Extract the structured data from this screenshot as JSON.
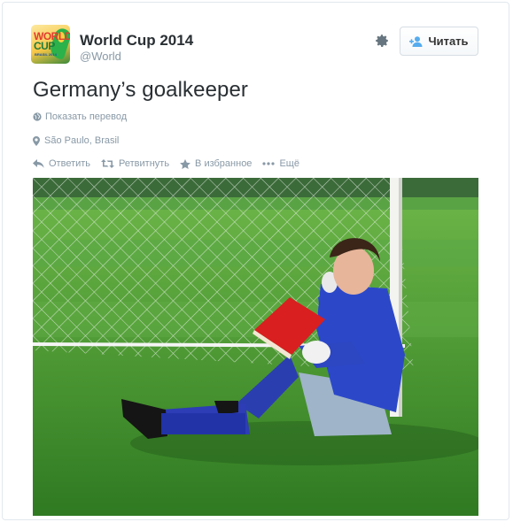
{
  "account": {
    "name": "World Cup 2014",
    "handle": "@World",
    "avatar_text": [
      "WORLD",
      "CUP",
      "BRASIL 2014"
    ]
  },
  "follow_button": {
    "label": "Читать"
  },
  "tweet": {
    "text": "Germany’s goalkeeper"
  },
  "translate_link": "Показать перевод",
  "location": "São Paulo, Brasil",
  "actions": {
    "reply": "Ответить",
    "retweet": "Ретвитнуть",
    "favorite": "В избранное",
    "more": "Ещё"
  },
  "colors": {
    "meta_text": "#8899a6",
    "name_text": "#292f33",
    "card_border": "#e1e8ed",
    "follow_icon": "#55acee"
  },
  "icons": [
    "gear-icon",
    "add-user-icon",
    "globe-icon",
    "location-pin-icon",
    "reply-icon",
    "retweet-icon",
    "star-icon",
    "more-dots-icon"
  ]
}
